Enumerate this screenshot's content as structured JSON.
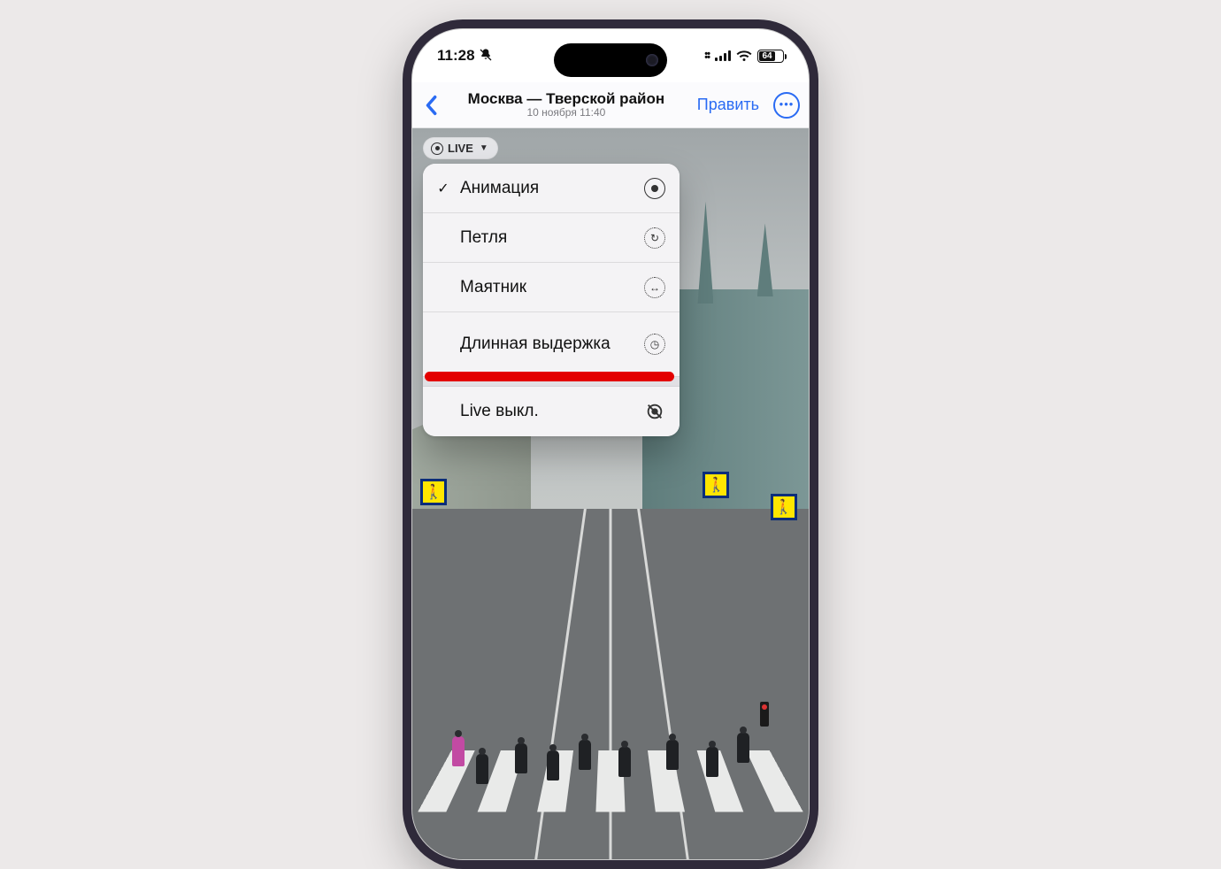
{
  "status": {
    "time": "11:28",
    "muted": true,
    "battery_pct": "64"
  },
  "nav": {
    "title": "Москва — Тверской район",
    "subtitle": "10 ноября  11:40",
    "edit_label": "Править"
  },
  "live_badge": {
    "label": "LIVE"
  },
  "menu": {
    "items": [
      {
        "label": "Анимация",
        "checked": true,
        "icon": "live-icon"
      },
      {
        "label": "Петля",
        "checked": false,
        "icon": "loop-icon"
      },
      {
        "label": "Маятник",
        "checked": false,
        "icon": "bounce-icon"
      },
      {
        "label": "Длинная выдержка",
        "checked": false,
        "icon": "long-exposure-icon",
        "highlighted": true
      }
    ],
    "off": {
      "label": "Live выкл.",
      "icon": "live-off-icon"
    }
  }
}
